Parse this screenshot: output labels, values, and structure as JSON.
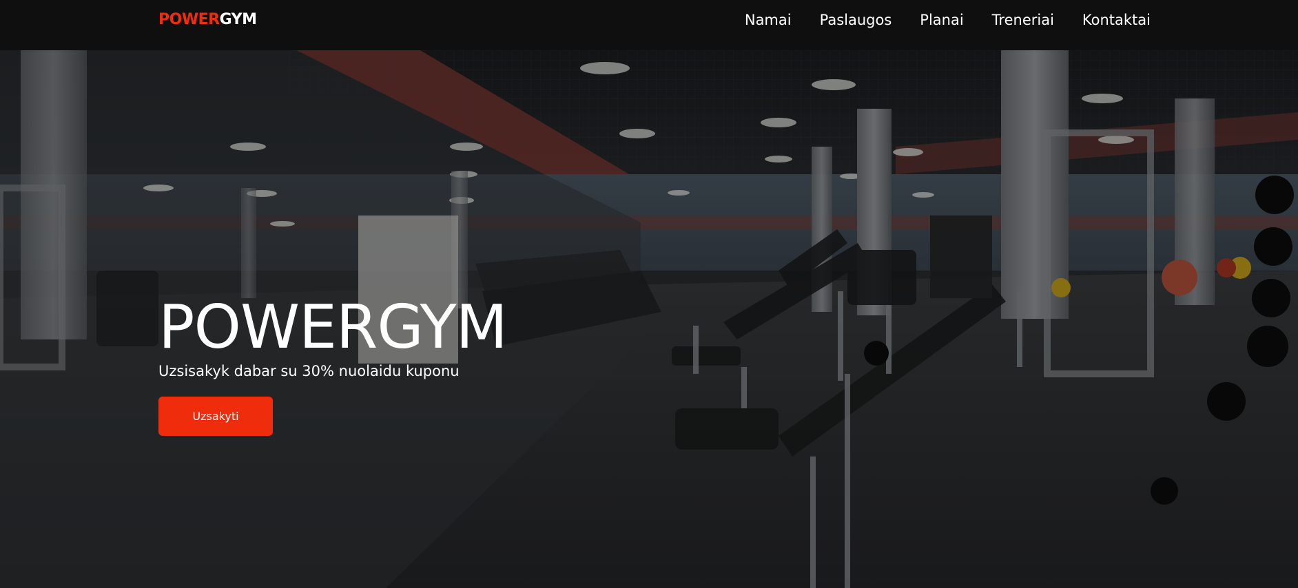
{
  "brand": {
    "logo_accent": "POWER",
    "logo_rest": "GYM",
    "accent_color": "#ef2d0c"
  },
  "nav": {
    "items": [
      {
        "label": "Namai"
      },
      {
        "label": "Paslaugos"
      },
      {
        "label": "Planai"
      },
      {
        "label": "Treneriai"
      },
      {
        "label": "Kontaktai"
      }
    ]
  },
  "hero": {
    "title": "POWERGYM",
    "subtitle": "Uzsisakyk dabar su 30% nuolaidu kuponu",
    "cta_label": "Uzsakyti",
    "background": "gym-interior-image"
  }
}
